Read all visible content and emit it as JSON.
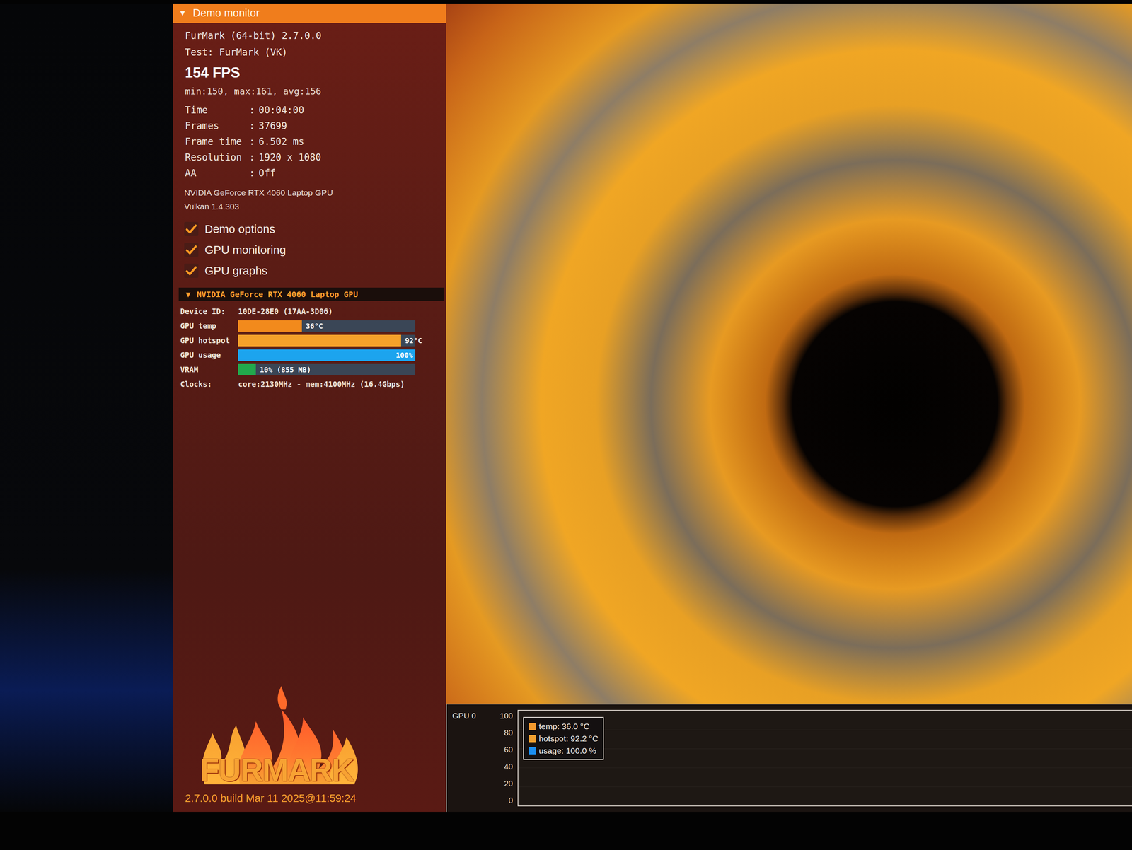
{
  "monitor": {
    "collapse_icon": "▼",
    "title": "Demo monitor"
  },
  "app": {
    "name": "FurMark (64-bit) 2.7.0.0",
    "test": "Test: FurMark (VK)"
  },
  "fps": {
    "current": "154 FPS",
    "summary": "min:150, max:161, avg:156"
  },
  "stat_separator": ":",
  "stats": [
    {
      "label": "Time",
      "value": "00:04:00"
    },
    {
      "label": "Frames",
      "value": "37699"
    },
    {
      "label": "Frame time",
      "value": "6.502 ms"
    },
    {
      "label": "Resolution",
      "value": "1920 x 1080"
    },
    {
      "label": "AA",
      "value": "Off"
    }
  ],
  "gpu": {
    "name": "NVIDIA GeForce RTX 4060 Laptop GPU",
    "api": "Vulkan 1.4.303"
  },
  "options": [
    {
      "label": "Demo options",
      "checked": true
    },
    {
      "label": "GPU monitoring",
      "checked": true
    },
    {
      "label": "GPU graphs",
      "checked": true
    }
  ],
  "gpu_section": {
    "collapse_icon": "▼",
    "title": "NVIDIA GeForce RTX 4060 Laptop GPU",
    "device_label": "Device ID:",
    "device_id": "10DE-28E0 (17AA-3D06)",
    "meters": [
      {
        "label": "GPU temp",
        "level": 0.36,
        "reading": "36°C",
        "color": "#f28a1c"
      },
      {
        "label": "GPU hotspot",
        "level": 0.92,
        "reading": "92°C",
        "color": "#f5a12a"
      },
      {
        "label": "GPU usage",
        "level": 1.0,
        "reading": "100%",
        "color": "#1ca4ee"
      },
      {
        "label": "VRAM",
        "level": 0.1,
        "reading": "10% (855 MB)",
        "color": "#22a94c"
      }
    ],
    "clocks_label": "Clocks:",
    "clocks": "core:2130MHz - mem:4100MHz (16.4Gbps)"
  },
  "logo": {
    "text": "FURMARK"
  },
  "build": "2.7.0.0 build Mar 11 2025@11:59:24",
  "graph": {
    "title": "GPU 0",
    "ticks": [
      "100",
      "80",
      "60",
      "40",
      "20",
      "0"
    ],
    "legend": [
      {
        "label": "temp: 36.0 °C",
        "color": "#f29a2e"
      },
      {
        "label": "hotspot: 92.2 °C",
        "color": "#f0a030"
      },
      {
        "label": "usage: 100.0 %",
        "color": "#1c8ff0"
      }
    ]
  }
}
